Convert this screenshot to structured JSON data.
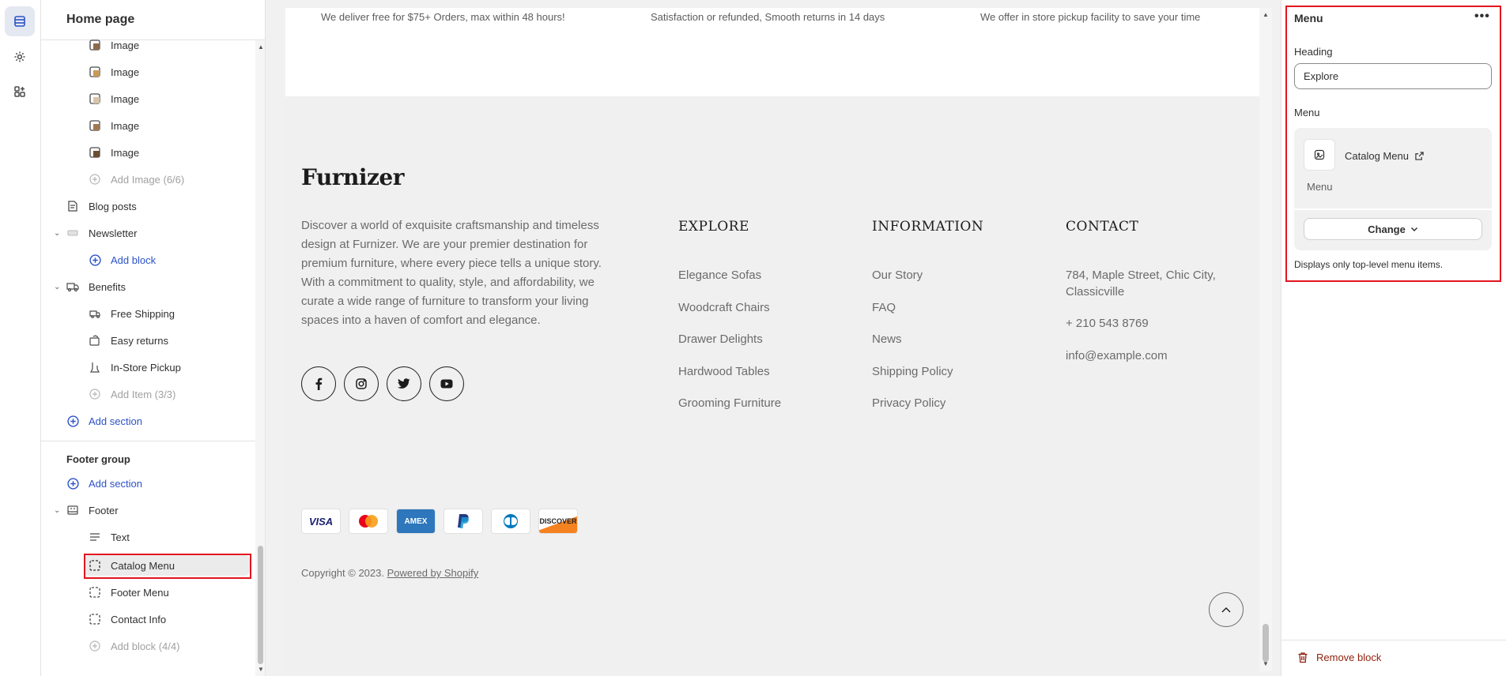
{
  "sidebar": {
    "title": "Home page",
    "image_items": [
      "Image",
      "Image",
      "Image",
      "Image",
      "Image"
    ],
    "add_image": "Add Image (6/6)",
    "blog_posts": "Blog posts",
    "newsletter": "Newsletter",
    "newsletter_add_block": "Add block",
    "benefits": "Benefits",
    "benefit_items": [
      "Free Shipping",
      "Easy returns",
      "In-Store Pickup"
    ],
    "add_item": "Add Item (3/3)",
    "add_section": "Add section",
    "footer_group_title": "Footer group",
    "footer_add_section": "Add section",
    "footer": "Footer",
    "footer_items": [
      "Text",
      "Catalog Menu",
      "Footer Menu",
      "Contact Info"
    ],
    "footer_add_block": "Add block (4/4)"
  },
  "preview": {
    "benefits": [
      "We deliver free for $75+ Orders, max within 48 hours!",
      "Satisfaction or refunded, Smooth returns in 14 days",
      "We offer in store pickup facility to save your time"
    ],
    "logo": "Furnizer",
    "about": "Discover a world of exquisite craftsmanship and timeless design at Furnizer. We are your premier destination for premium furniture, where every piece tells a unique story. With a commitment to quality, style, and affordability, we curate a wide range of furniture to transform your living spaces into a haven of comfort and elegance.",
    "socials": [
      "facebook-icon",
      "instagram-icon",
      "twitter-icon",
      "youtube-icon"
    ],
    "explore": {
      "heading": "EXPLORE",
      "links": [
        "Elegance Sofas",
        "Woodcraft Chairs",
        "Drawer Delights",
        "Hardwood Tables",
        "Grooming Furniture"
      ]
    },
    "information": {
      "heading": "INFORMATION",
      "links": [
        "Our Story",
        "FAQ",
        "News",
        "Shipping Policy",
        "Privacy Policy"
      ]
    },
    "contact": {
      "heading": "CONTACT",
      "address_line1": "784, Maple Street, Chic City,",
      "address_line2": "Classicville",
      "phone": "+ 210 543 8769",
      "email": "info@example.com"
    },
    "payments": [
      "VISA",
      "mastercard",
      "AMEX",
      "PayPal",
      "Diners",
      "DISCOVER"
    ],
    "copyright_prefix": "Copyright © 2023.",
    "copyright_link": "Powered by Shopify"
  },
  "panel": {
    "title": "Menu",
    "heading_label": "Heading",
    "heading_value": "Explore",
    "menu_label": "Menu",
    "menu_name": "Catalog Menu",
    "menu_sub": "Menu",
    "change_label": "Change",
    "note": "Displays only top-level menu items.",
    "remove_label": "Remove block"
  },
  "colors": {
    "accent_link": "#2c52c9",
    "highlight_red": "#e3141e",
    "remove_red": "#8e1f0b"
  }
}
